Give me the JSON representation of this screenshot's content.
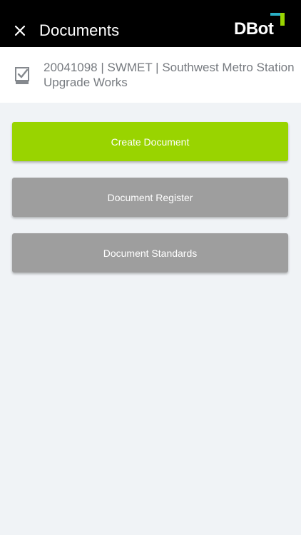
{
  "header": {
    "title": "Documents",
    "close_icon": "close-icon",
    "logo_text": "DBot",
    "logo_colors": {
      "teal": "#2ab0c6",
      "green": "#99d400"
    }
  },
  "project": {
    "icon": "checklist-icon",
    "text": "20041098 | SWMET | Southwest Metro Station\nUpgrade Works"
  },
  "actions": {
    "create_label": "Create Document",
    "register_label": "Document Register",
    "standards_label": "Document Standards"
  },
  "colors": {
    "topbar": "#000000",
    "create_button": "#99d400",
    "secondary_button": "#9e9e9e",
    "background": "#f0f3f6"
  }
}
